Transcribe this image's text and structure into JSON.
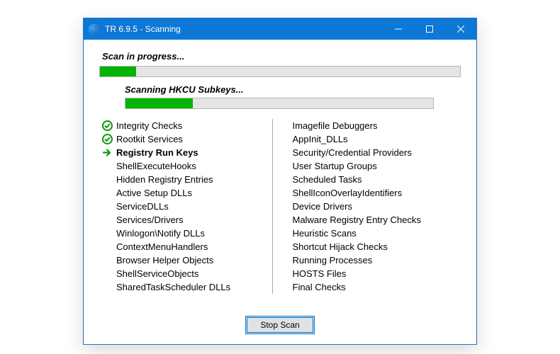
{
  "titlebar": {
    "title": "TR 6.9.5 - Scanning"
  },
  "scan": {
    "heading": "Scan in progress...",
    "progress_pct": 10,
    "sub_heading": "Scanning HKCU Subkeys...",
    "sub_progress_pct": 22
  },
  "items_left": [
    {
      "label": "Integrity Checks",
      "status": "done"
    },
    {
      "label": "Rootkit Services",
      "status": "done"
    },
    {
      "label": "Registry Run Keys",
      "status": "current"
    },
    {
      "label": "ShellExecuteHooks",
      "status": "pending"
    },
    {
      "label": "Hidden Registry Entries",
      "status": "pending"
    },
    {
      "label": "Active Setup DLLs",
      "status": "pending"
    },
    {
      "label": "ServiceDLLs",
      "status": "pending"
    },
    {
      "label": "Services/Drivers",
      "status": "pending"
    },
    {
      "label": "Winlogon\\Notify DLLs",
      "status": "pending"
    },
    {
      "label": "ContextMenuHandlers",
      "status": "pending"
    },
    {
      "label": "Browser Helper Objects",
      "status": "pending"
    },
    {
      "label": "ShellServiceObjects",
      "status": "pending"
    },
    {
      "label": "SharedTaskScheduler DLLs",
      "status": "pending"
    }
  ],
  "items_right": [
    {
      "label": "Imagefile Debuggers"
    },
    {
      "label": "AppInit_DLLs"
    },
    {
      "label": "Security/Credential Providers"
    },
    {
      "label": "User Startup Groups"
    },
    {
      "label": "Scheduled Tasks"
    },
    {
      "label": "ShellIconOverlayIdentifiers"
    },
    {
      "label": "Device Drivers"
    },
    {
      "label": "Malware Registry Entry Checks"
    },
    {
      "label": "Heuristic Scans"
    },
    {
      "label": "Shortcut Hijack Checks"
    },
    {
      "label": "Running Processes"
    },
    {
      "label": "HOSTS Files"
    },
    {
      "label": "Final Checks"
    }
  ],
  "buttons": {
    "stop": "Stop Scan"
  }
}
